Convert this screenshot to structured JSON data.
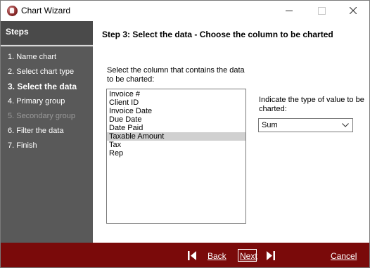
{
  "window": {
    "title": "Chart Wizard"
  },
  "sidebar": {
    "header": "Steps",
    "steps": [
      {
        "label": "1. Name chart",
        "state": "normal"
      },
      {
        "label": "2. Select chart type",
        "state": "normal"
      },
      {
        "label": "3. Select the data",
        "state": "current"
      },
      {
        "label": "4. Primary group",
        "state": "normal"
      },
      {
        "label": "5. Secondary group",
        "state": "disabled"
      },
      {
        "label": "6. Filter the data",
        "state": "normal"
      },
      {
        "label": "7. Finish",
        "state": "normal"
      }
    ]
  },
  "main": {
    "heading": "Step 3: Select the data - Choose the column to be charted",
    "column_prompt": "Select the column that contains the data to be charted:",
    "columns": [
      "Invoice #",
      "Client ID",
      "Invoice Date",
      "Due Date",
      "Date Paid",
      "Taxable Amount",
      "Tax",
      "Rep"
    ],
    "selected_column": "Taxable Amount",
    "type_prompt": "Indicate the type of value to be charted:",
    "value_type": "Sum"
  },
  "footer": {
    "back_label": "Back",
    "next_label": "Next",
    "cancel_label": "Cancel"
  },
  "colors": {
    "sidebar_bg": "#595959",
    "footer_bg": "#7a0a0a",
    "selection_bg": "#d0d0d0"
  }
}
